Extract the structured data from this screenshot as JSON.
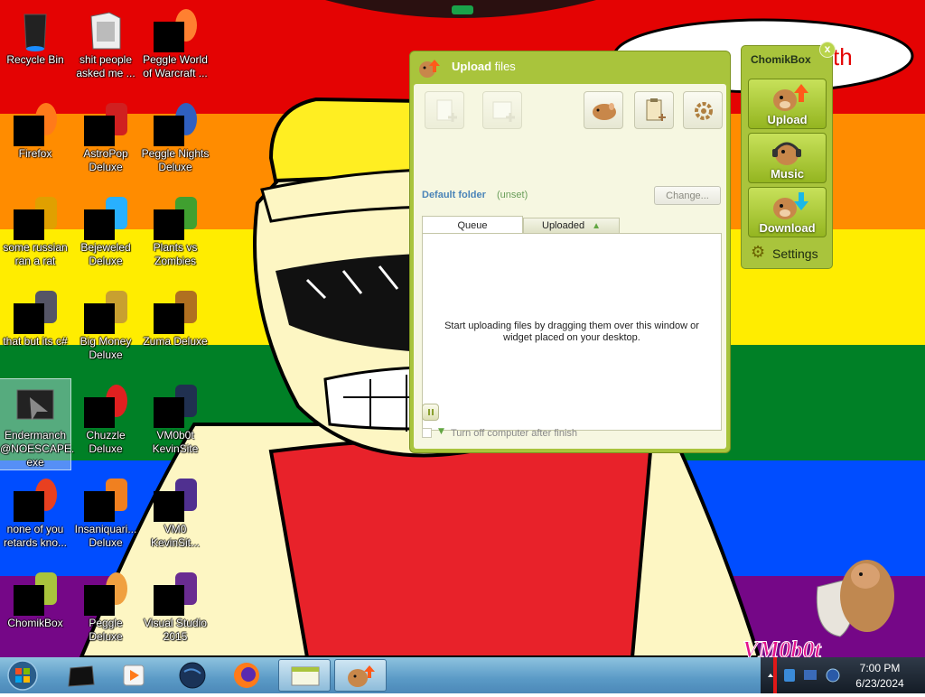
{
  "desktop": {
    "icons": [
      {
        "label": "Recycle Bin"
      },
      {
        "label": "shit people\nasked me ..."
      },
      {
        "label": "Peggle World\nof Warcraft ..."
      },
      {
        "label": "Firefox"
      },
      {
        "label": "AstroPop\nDeluxe"
      },
      {
        "label": "Peggle Nights\nDeluxe"
      },
      {
        "label": "some russian\nran a rat"
      },
      {
        "label": "Bejeweled\nDeluxe"
      },
      {
        "label": "Plants vs\nZombies"
      },
      {
        "label": "that but its c#"
      },
      {
        "label": "Big Money\nDeluxe"
      },
      {
        "label": "Zuma Deluxe"
      },
      {
        "label": "Endermanch\n@NOESCAPE.\nexe"
      },
      {
        "label": "Chuzzle\nDeluxe"
      },
      {
        "label": "VM0b0t\nKevinSite"
      },
      {
        "label": "none of you\nretards kno..."
      },
      {
        "label": "Insaniquari...\nDeluxe"
      },
      {
        "label": "VM0\nKevinSit..."
      },
      {
        "label": "ChomikBox"
      },
      {
        "label": "Peggle Deluxe"
      },
      {
        "label": "Visual Studio\n2015"
      }
    ],
    "wallpaper_text": "VM0b0t",
    "speech_text": "th"
  },
  "upload_window": {
    "title_bold": "Upload",
    "title_rest": " files",
    "default_folder_label": "Default folder",
    "default_folder_value": "(unset)",
    "change_button": "Change...",
    "tabs": {
      "queue": "Queue",
      "uploaded": "Uploaded",
      "uploaded_arrow": "▲"
    },
    "queue_hint": "Start uploading files by dragging them over this window or\nwidget placed on your desktop.",
    "shutdown_arrow": "▼",
    "shutdown_label": "Turn off computer after finish",
    "shutdown_checked": false
  },
  "widget": {
    "title": "ChomikBox",
    "close": "x",
    "buttons": [
      {
        "label": "Upload"
      },
      {
        "label": "Music"
      },
      {
        "label": "Download"
      }
    ],
    "settings_icon": "⚙",
    "settings_label": "Settings"
  },
  "taskbar": {
    "time": "7:00 PM",
    "date": "6/23/2024"
  },
  "colors": {
    "chomik_green": "#a9c43c",
    "panel_bg": "#f6f7e1",
    "link_blue": "#4a84b8"
  }
}
